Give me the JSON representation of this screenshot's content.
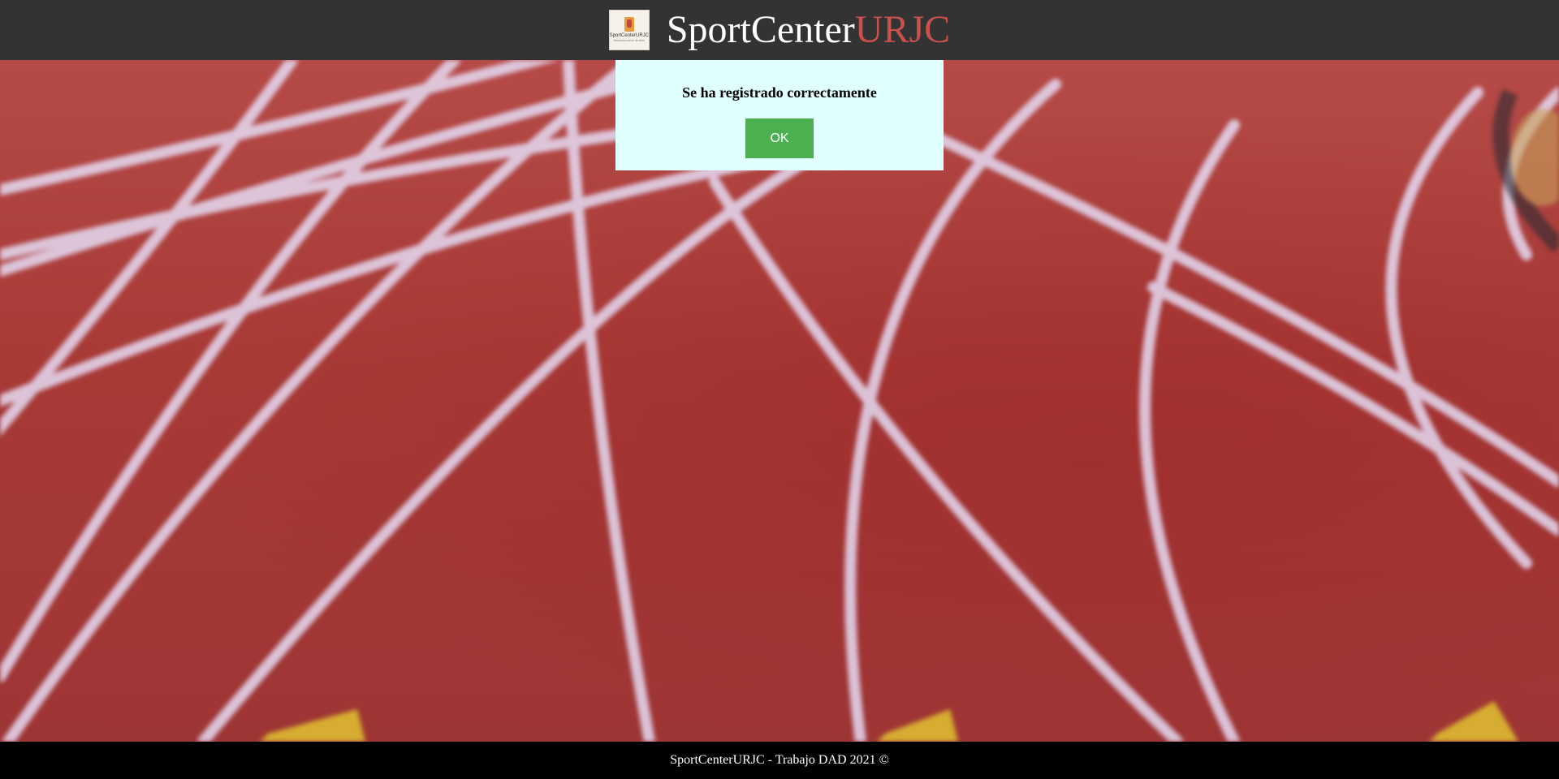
{
  "header": {
    "logo_text": "SportCenterURJC",
    "logo_subtext": "Reservas online de tenis",
    "title_main": "SportCenter",
    "title_accent": "URJC"
  },
  "dialog": {
    "message": "Se ha registrado correctamente",
    "ok_label": "OK"
  },
  "footer": {
    "text": "SportCenterURJC - Trabajo DAD 2021 ©"
  },
  "colors": {
    "header_bg": "#333333",
    "title_accent": "#c9504b",
    "dialog_bg": "#e0ffff",
    "ok_button": "#4caf50",
    "footer_bg": "#000000"
  }
}
